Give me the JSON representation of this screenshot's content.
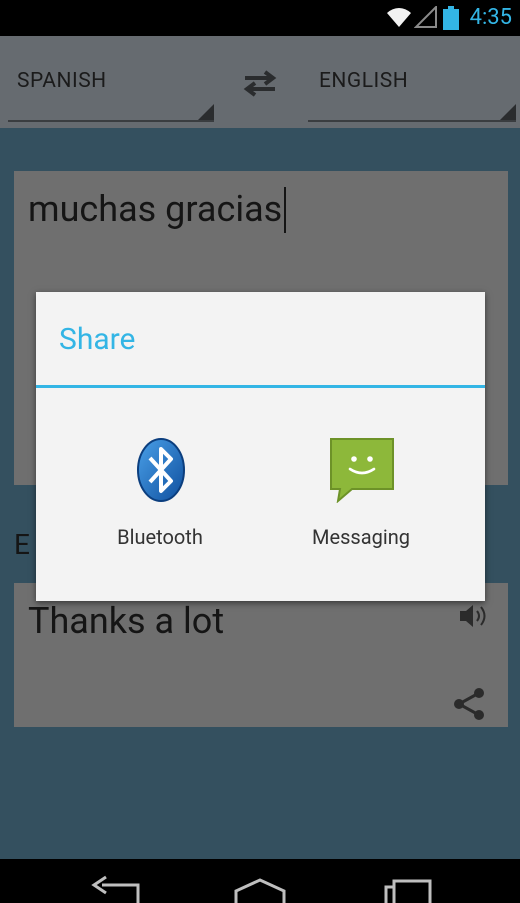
{
  "status_bar": {
    "time": "4:35"
  },
  "language_bar": {
    "source_language": "SPANISH",
    "target_language": "ENGLISH"
  },
  "translator": {
    "input_text": "muchas gracias",
    "output_language_letter": "E",
    "output_text": "Thanks a lot"
  },
  "share_dialog": {
    "title": "Share",
    "options": [
      {
        "label": "Bluetooth",
        "icon": "bluetooth-icon"
      },
      {
        "label": "Messaging",
        "icon": "messaging-icon"
      }
    ]
  },
  "colors": {
    "accent": "#33b5e5",
    "messaging_green": "#8db83a",
    "bluetooth_blue": "#1e6bb8"
  }
}
